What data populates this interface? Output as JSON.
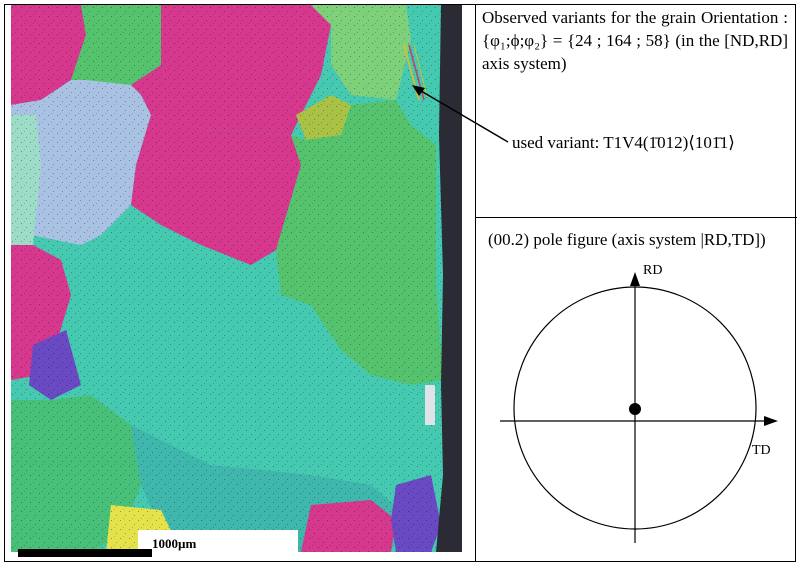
{
  "caption": {
    "observed_variants": "Observed variants for the grain Orientation : {φ₁;ϕ;φ₂} = {24 ; 164 ; 58} (in the [ND,RD] axis system)",
    "used_variant": "used variant: T1V4(1̄012)⟨101̄1⟩",
    "pole_figure_title": "(00.2) pole figure (axis system |RD,TD])"
  },
  "pole_figure": {
    "axis_up_label": "RD",
    "axis_right_label": "TD",
    "pole_marker": "•"
  },
  "micrograph": {
    "scale_bar_label": "1000µm"
  },
  "colors": {
    "magenta": "#d6388e",
    "cyan_green": "#45c9b0",
    "green": "#55c36d",
    "light_blue": "#a9c2e3",
    "olive": "#a9c245",
    "purple": "#6a4ac3",
    "yellow": "#e4e24a",
    "dark_edge": "#2a2b34"
  }
}
